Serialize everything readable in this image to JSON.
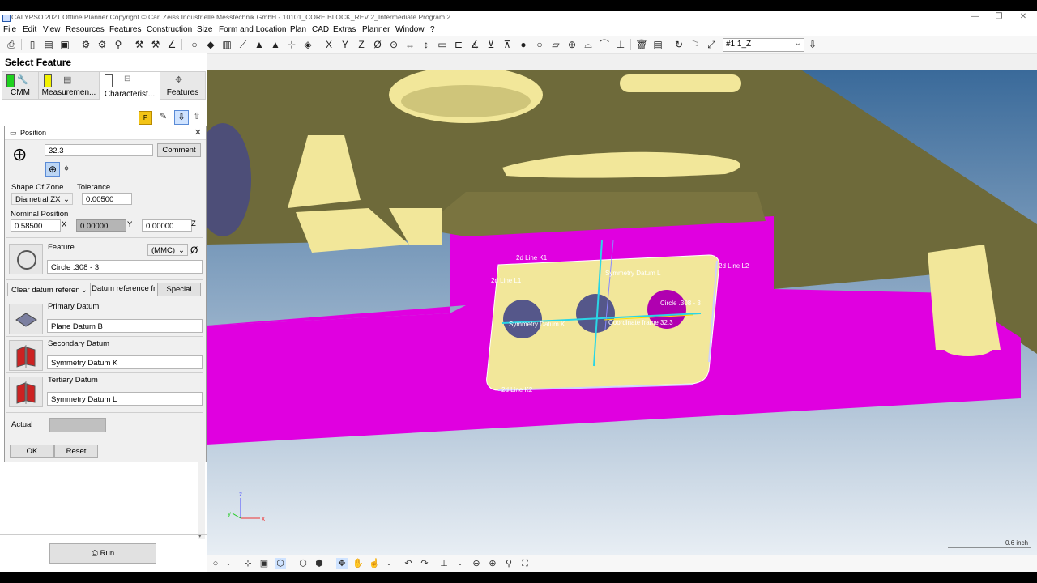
{
  "window": {
    "title": "CALYPSO 2021 Offline Planner Copyright © Carl Zeiss Industrielle Messtechnik GmbH - 10101_CORE BLOCK_REV 2_Intermediate Program 2"
  },
  "menu": [
    "File",
    "Edit",
    "View",
    "Resources",
    "Features",
    "Construction",
    "Size",
    "Form and Location",
    "Plan",
    "CAD",
    "Extras",
    "Planner",
    "Window",
    "?"
  ],
  "toolbar": {
    "combo_value": "#1     1_Z"
  },
  "left_panel": {
    "title": "Select Feature",
    "tabs": [
      {
        "label": "CMM"
      },
      {
        "label": "Measuremen..."
      },
      {
        "label": "Characterist..."
      },
      {
        "label": "Features"
      }
    ],
    "mini_toolbar": {
      "p_label": "P"
    }
  },
  "dialog": {
    "title": "Position",
    "name_value": "32.3",
    "comment_label": "Comment",
    "shape_of_zone_label": "Shape Of Zone",
    "shape_of_zone_value": "Diametral ZX",
    "tolerance_label": "Tolerance",
    "tolerance_value": "0.00500",
    "nominal_position_label": "Nominal Position",
    "nominal_x": "0.58500",
    "x_label": "X",
    "nominal_y": "0.00000",
    "y_label": "Y",
    "nominal_z": "0.00000",
    "z_label": "Z",
    "feature_label": "Feature",
    "mmc_value": "(MMC)",
    "diameter_symbol": "Ø",
    "feature_value": "Circle .308 - 3",
    "clear_datum_value": "Clear datum referen",
    "datum_ref_label": "Datum reference fr",
    "special_label": "Special",
    "primary_label": "Primary Datum",
    "primary_value": "Plane Datum B",
    "secondary_label": "Secondary Datum",
    "secondary_value": "Symmetry Datum K",
    "tertiary_label": "Tertiary Datum",
    "tertiary_value": "Symmetry Datum L",
    "actual_label": "Actual",
    "ok_label": "OK",
    "reset_label": "Reset"
  },
  "run_label": "Run",
  "viewport": {
    "labels": [
      "2d Line K1",
      "2d Line L1",
      "2d Line L2",
      "2d Line K2",
      "Symmetry Datum L",
      "Symmetry Datum K",
      "Circle .308 - 3",
      "Coordinate frame 32.3"
    ],
    "scale_label": "0.6 inch",
    "axes": {
      "x": "x",
      "y": "y",
      "z": "z"
    },
    "colors": {
      "part": "#6e6a3a",
      "face": "#f2e79a",
      "magenta": "#e000e0",
      "background_top": "#3a6a9a"
    }
  }
}
